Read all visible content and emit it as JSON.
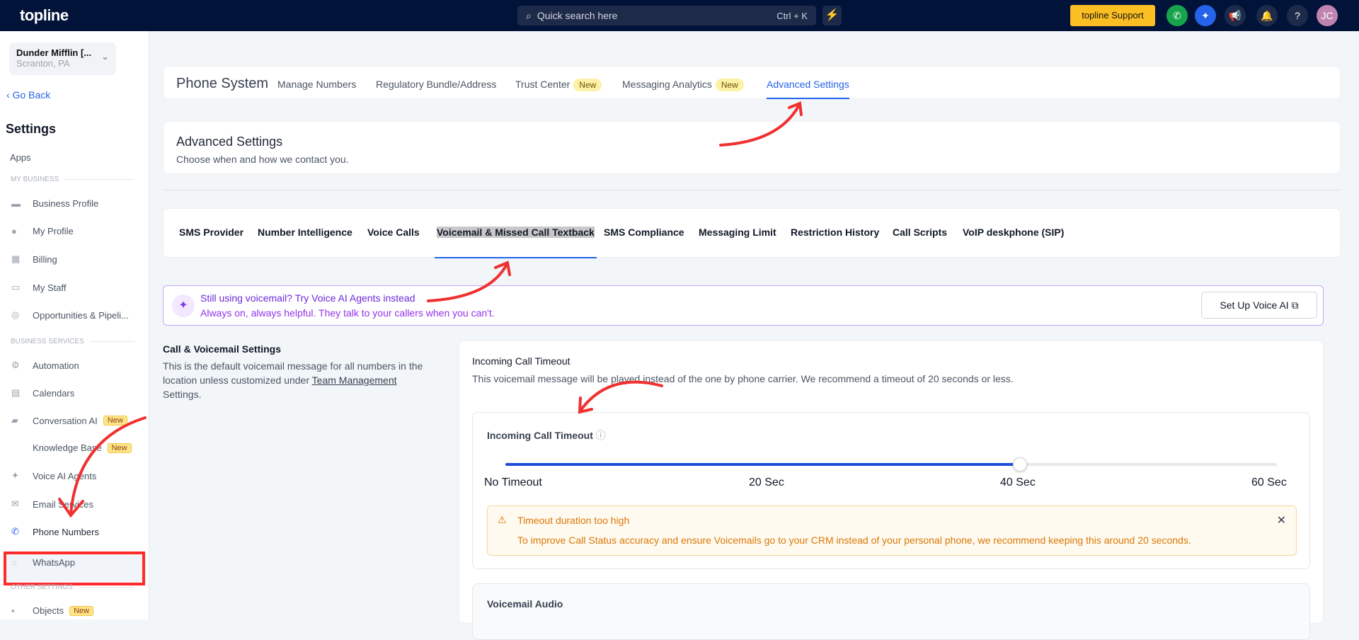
{
  "topbar": {
    "logo": "topline",
    "search_placeholder": "Quick search here",
    "search_shortcut": "Ctrl + K",
    "support": "topline Support",
    "avatar": "JC"
  },
  "sidebar": {
    "location_name": "Dunder Mifflin [...",
    "location_city": "Scranton, PA",
    "go_back": "Go Back",
    "title": "Settings",
    "apps": "Apps",
    "sections": [
      "MY BUSINESS",
      "BUSINESS SERVICES",
      "OTHER SETTINGS"
    ],
    "items": [
      {
        "label": "Business Profile",
        "icon": "briefcase-icon"
      },
      {
        "label": "My Profile",
        "icon": "user-icon"
      },
      {
        "label": "Billing",
        "icon": "grid-icon"
      },
      {
        "label": "My Staff",
        "icon": "inbox-icon"
      },
      {
        "label": "Opportunities & Pipeli...",
        "icon": "target-icon"
      },
      {
        "label": "Automation",
        "icon": "gears-icon"
      },
      {
        "label": "Calendars",
        "icon": "calendar-icon"
      },
      {
        "label": "Conversation AI",
        "badge": "New",
        "icon": "chat-icon"
      },
      {
        "label": "Knowledge Base",
        "badge": "New"
      },
      {
        "label": "Voice AI Agents",
        "icon": "sparkle-icon"
      },
      {
        "label": "Email Services",
        "icon": "mail-icon"
      },
      {
        "label": "Phone Numbers",
        "icon": "phone-icon"
      },
      {
        "label": "WhatsApp",
        "icon": "whatsapp-icon"
      },
      {
        "label": "Objects",
        "badge": "New",
        "icon": "objects-icon"
      }
    ]
  },
  "header": {
    "title": "Phone System",
    "tabs": [
      {
        "label": "Manage Numbers"
      },
      {
        "label": "Regulatory Bundle/Address"
      },
      {
        "label": "Trust Center",
        "badge": "New"
      },
      {
        "label": "Messaging Analytics",
        "badge": "New"
      },
      {
        "label": "Advanced Settings"
      }
    ]
  },
  "advanced": {
    "title": "Advanced Settings",
    "subtitle": "Choose when and how we contact you."
  },
  "subtabs": [
    "SMS Provider",
    "Number Intelligence",
    "Voice Calls",
    "Voicemail & Missed Call Textback",
    "SMS Compliance",
    "Messaging Limit",
    "Restriction History",
    "Call Scripts",
    "VoIP deskphone (SIP)"
  ],
  "banner": {
    "title": "Still using voicemail? Try Voice AI Agents instead",
    "text": "Always on, always helpful. They talk to your callers when you can't.",
    "button": "Set Up Voice AI"
  },
  "left": {
    "title": "Call & Voicemail Settings",
    "text": "This is the default voicemail message for all numbers in the location unless customized under",
    "link": "Team Management",
    "text2": "Settings."
  },
  "timeout": {
    "title": "Incoming Call Timeout",
    "desc": "This voicemail message will be played instead of the one by phone carrier. We recommend a timeout of 20 seconds or less.",
    "label": "Incoming Call Timeout",
    "ticks": [
      "No Timeout",
      "20 Sec",
      "40 Sec",
      "60 Sec"
    ],
    "value_seconds": 40,
    "max_seconds": 60,
    "warning_title": "Timeout duration too high",
    "warning_text": "To improve Call Status accuracy and ensure Voicemails go to your CRM instead of your personal phone, we recommend keeping this around 20 seconds."
  },
  "voicemail_audio": {
    "title": "Voicemail Audio"
  }
}
